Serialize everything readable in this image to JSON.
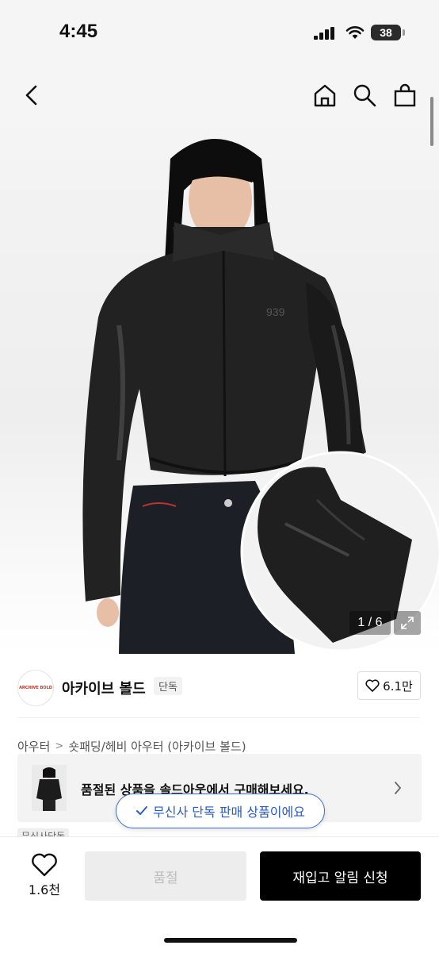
{
  "status_bar": {
    "time": "4:45",
    "battery": "38"
  },
  "hero": {
    "counter": "1 / 6",
    "model_text": "939"
  },
  "brand": {
    "logo_text": "ARCHIVE BOLD",
    "name": "아카이브 볼드",
    "badge": "단독",
    "likes": "6.1만"
  },
  "breadcrumb": {
    "category": "아우터",
    "subcategory": "숏패딩/헤비 아우터 (아카이브 볼드)"
  },
  "soldout_banner": {
    "text": "품절된 상품을 솔드아웃에서 구매해보세요."
  },
  "exclusive": {
    "pill_text": "무신사 단독 판매 상품이에요",
    "tag_text": "무신사단독"
  },
  "bottom_bar": {
    "wish_count": "1.6천",
    "soldout_label": "품절",
    "restock_label": "재입고 알림 신청"
  },
  "colors": {
    "accent_blue": "#2a5bc9",
    "primary_black": "#000000",
    "disabled_gray": "#ededed"
  },
  "icons": [
    "back-icon",
    "home-icon",
    "search-icon",
    "shopping-bag-icon",
    "expand-icon",
    "heart-icon",
    "chevron-right-icon",
    "checkmark-icon"
  ]
}
